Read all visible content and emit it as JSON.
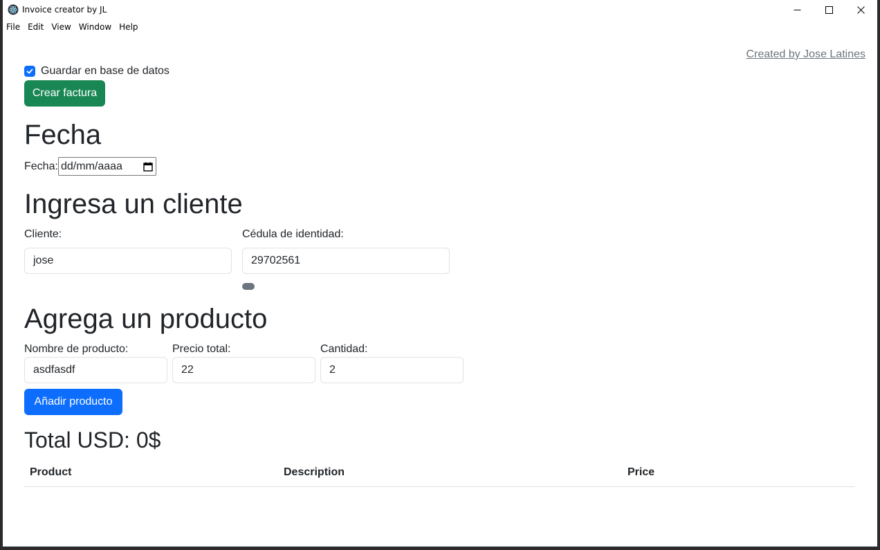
{
  "window": {
    "title": "Invoice creator by JL",
    "controls": {
      "minimize": "─",
      "maximize": "☐",
      "close": "✕"
    }
  },
  "menu": [
    "File",
    "Edit",
    "View",
    "Window",
    "Help"
  ],
  "credit": "Created by Jose Latines",
  "save_db": {
    "label": "Guardar en base de datos",
    "checked": true
  },
  "create_button": "Crear factura",
  "date_section": {
    "heading": "Fecha",
    "label": "Fecha:",
    "placeholder": "dd/mm/aaaa"
  },
  "client_section": {
    "heading": "Ingresa un cliente",
    "client_label": "Cliente:",
    "client_value": "jose",
    "id_label": "Cédula de identidad:",
    "id_value": "29702561"
  },
  "product_section": {
    "heading": "Agrega un producto",
    "name_label": "Nombre de producto:",
    "name_value": "asdfasdf",
    "price_label": "Precio total:",
    "price_value": "22",
    "qty_label": "Cantidad:",
    "qty_value": "2",
    "add_button": "Añadir producto"
  },
  "total": "Total USD: 0$",
  "table": {
    "headers": [
      "Product",
      "Description",
      "Price"
    ]
  },
  "colors": {
    "success": "#198754",
    "primary": "#0d6efd",
    "secondary": "#6c757d"
  }
}
